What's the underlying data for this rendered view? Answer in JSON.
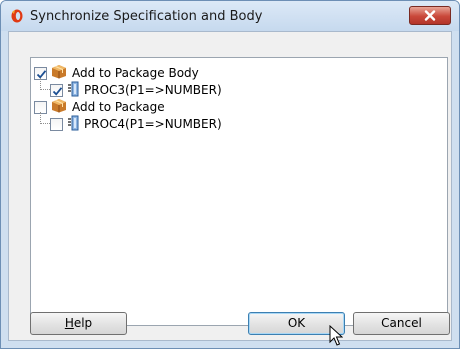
{
  "window": {
    "title": "Synchronize Specification and Body"
  },
  "tree": [
    {
      "label": "Add to Package Body",
      "checked": true,
      "icon": "package-icon",
      "child": {
        "label": "PROC3(P1=>NUMBER)",
        "checked": true,
        "icon": "procedure-icon"
      }
    },
    {
      "label": "Add to Package",
      "checked": false,
      "icon": "package-icon",
      "child": {
        "label": "PROC4(P1=>NUMBER)",
        "checked": false,
        "icon": "procedure-icon"
      }
    }
  ],
  "buttons": {
    "help_mnemonic": "H",
    "help_rest": "elp",
    "ok": "OK",
    "cancel": "Cancel"
  },
  "colors": {
    "title_bar": "#c6d9ee",
    "close_button": "#c9483a",
    "check": "#1c4f92"
  }
}
